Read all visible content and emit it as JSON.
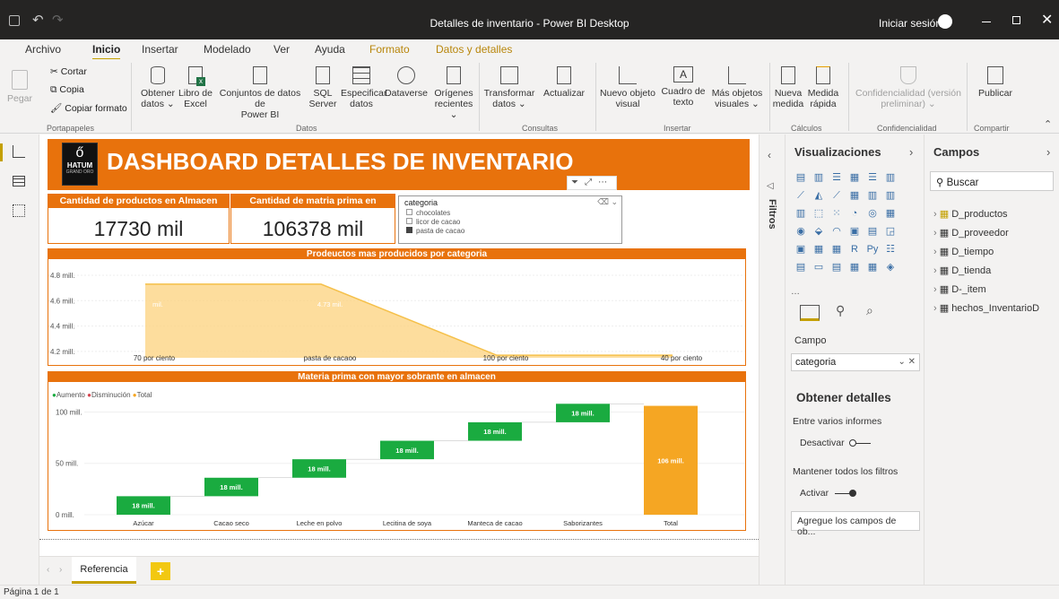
{
  "window": {
    "title": "Detalles de inventario - Power BI Desktop",
    "signin": "Iniciar sesión"
  },
  "menu": [
    "Archivo",
    "Inicio",
    "Insertar",
    "Modelado",
    "Ver",
    "Ayuda",
    "Formato",
    "Datos y detalles"
  ],
  "ribbon": {
    "pegar": "Pegar",
    "cortar": "Cortar",
    "copia": "Copia",
    "copiar_formato": "Copiar formato",
    "portapapeles": "Portapapeles",
    "obtener_datos": [
      "Obtener",
      "datos ⌄"
    ],
    "libro_excel": [
      "Libro de",
      "Excel"
    ],
    "conjuntos": [
      "Conjuntos de datos de",
      "Power BI"
    ],
    "sql": [
      "SQL",
      "Server"
    ],
    "especificar": [
      "Especificar",
      "datos"
    ],
    "dataverse": [
      "Dataverse",
      ""
    ],
    "origenes": [
      "Orígenes",
      "recientes ⌄"
    ],
    "datos": "Datos",
    "transformar": [
      "Transformar",
      "datos ⌄"
    ],
    "actualizar": [
      "Actualizar",
      ""
    ],
    "consultas": "Consultas",
    "nuevo_objeto": [
      "Nuevo objeto",
      "visual"
    ],
    "cuadro_texto": [
      "Cuadro de",
      "texto"
    ],
    "mas_objetos": [
      "Más objetos",
      "visuales ⌄"
    ],
    "insertar": "Insertar",
    "nueva_medida": [
      "Nueva",
      "medida"
    ],
    "medida_rapida": [
      "Medida",
      "rápida"
    ],
    "calculos": "Cálculos",
    "confidencialidad": [
      "Confidencialidad (versión",
      "preliminar) ⌄"
    ],
    "confidencialidad_g": "Confidencialidad",
    "publicar": "Publicar",
    "compartir": "Compartir"
  },
  "report": {
    "logo": "HATUM",
    "logo_sub": "GRAND ORO",
    "title": "DASHBOARD DETALLES DE INVENTARIO",
    "kpi1": {
      "label": "Cantidad de productos en Almacen",
      "value": "17730 mil"
    },
    "kpi2": {
      "label": "Cantidad de matria prima en Almacen",
      "value": "106378 mil"
    },
    "slicer": {
      "title": "categoria",
      "items": [
        {
          "label": "chocolates",
          "checked": false
        },
        {
          "label": "licor de cacao",
          "checked": false
        },
        {
          "label": "pasta de cacao",
          "checked": true
        }
      ]
    }
  },
  "chart_data": [
    {
      "type": "area",
      "title": "Prodeuctos mas producidos por categoria",
      "categories": [
        "70 por ciento",
        "pasta de cacaoo",
        "100 por ciento",
        "40 por ciento"
      ],
      "values": [
        4.73,
        4.73,
        4.17,
        4.17
      ],
      "data_labels": [
        "mil.",
        "4.73 mil.",
        "",
        ""
      ],
      "y_ticks": [
        "4.8 mill.",
        "4.6 mill.",
        "4.4 mill.",
        "4.2 mill."
      ],
      "ylim": [
        4.15,
        4.8
      ],
      "color": "#fcd27c"
    },
    {
      "type": "bar",
      "title": "Materia prima con mayor sobrante en almacen",
      "legend": [
        {
          "name": "Aumento",
          "color": "#1aab40"
        },
        {
          "name": "Disminución",
          "color": "#d64550"
        },
        {
          "name": "Total",
          "color": "#f5a623"
        }
      ],
      "categories": [
        "Azúcar",
        "Cacao seco",
        "Leche en polvo",
        "Lecitina de soya",
        "Manteca de cacao",
        "Saborizantes",
        "Total"
      ],
      "values": [
        18,
        18,
        18,
        18,
        18,
        18,
        106
      ],
      "data_labels": [
        "18 mill.",
        "18 mill.",
        "18 mill.",
        "18 mill.",
        "18 mill.",
        "18 mill.",
        "106 mill."
      ],
      "y_ticks": [
        "100 mill.",
        "50 mill.",
        "0 mill."
      ],
      "ylim": [
        0,
        110
      ]
    }
  ],
  "tabs": {
    "active": "Referencia",
    "add": "+"
  },
  "status": "Página 1 de 1",
  "filtros": "Filtros",
  "viz": {
    "title": "Visualizaciones",
    "campo": "Campo",
    "field_value": "categoria",
    "obtener": "Obtener detalles",
    "entre": "Entre varios informes",
    "desactivar": "Desactivar",
    "mantener": "Mantener todos los filtros",
    "activar": "Activar",
    "agregue": "Agregue los campos de ob..."
  },
  "campos": {
    "title": "Campos",
    "search": "Buscar",
    "items": [
      "D_productos",
      "D_proveedor",
      "D_tiempo",
      "D_tienda",
      "D-_item",
      "hechos_InventarioD"
    ]
  }
}
